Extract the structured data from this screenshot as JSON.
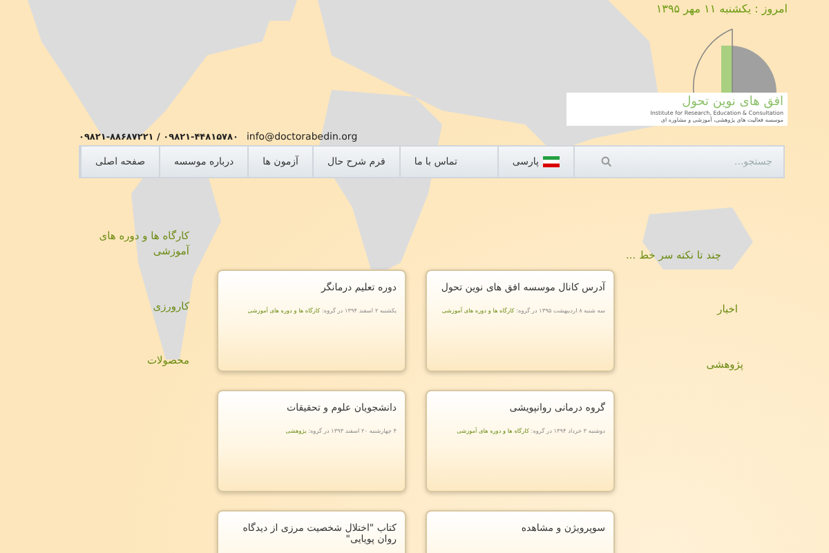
{
  "date_line": "امروز : یکشنبه ۱۱ مهر ۱۳۹۵",
  "logo": {
    "title": "افق های نوین تحول",
    "subtitle_en": "Institute for Research, Education & Consultation",
    "subtitle_fa": "موسسه فعالیت های پژوهشی، آموزشی و مشاوره ای"
  },
  "contact": {
    "phones": "۰۹۸۲۱-۸۸۶۸۷۲۲۱ / ۰۹۸۲۱-۴۴۸۱۵۷۸۰",
    "email": "info@doctorabedin.org"
  },
  "nav": {
    "search": {
      "placeholder": "جستجو..."
    },
    "language": "پارسی",
    "items": [
      {
        "label": "تماس با ما"
      },
      {
        "label": "فرم شرح حال"
      },
      {
        "label": "آزمون ها"
      },
      {
        "label": "درباره موسسه"
      },
      {
        "label": "صفحه اصلی"
      }
    ]
  },
  "right_sidebar": [
    "چند تا نکته سر خط ...",
    "اخبار",
    "پژوهشی"
  ],
  "left_sidebar": [
    "کارگاه ها و دوره های آموزشی",
    "کارورزی",
    "محصولات"
  ],
  "posts": [
    {
      "title": "آدرس کانال موسسه افق های نوین تحول",
      "date": "سه شنبه ۸ اردیبهشت ۱۳۹۵",
      "group_prefix": "در گروه:",
      "group": "کارگاه ها و دوره های آموزشی"
    },
    {
      "title": "دوره تعلیم درمانگر",
      "date": "یکشنبه ۲ اسفند ۱۳۹۴",
      "group_prefix": "در گروه:",
      "group": "کارگاه ها و دوره های آموزشی"
    },
    {
      "title": "گروه درمانی روانپویشی",
      "date": "دوشنبه ۳ خرداد ۱۳۹۴",
      "group_prefix": "در گروه:",
      "group": "کارگاه ها و دوره های آموزشی"
    },
    {
      "title": "دانشجویان علوم و تحقیقات",
      "date": "۴ چهارشنبه ۲۰ اسفند ۱۳۹۳",
      "group_prefix": "در گروه:",
      "group": "پژوهشی"
    },
    {
      "title": "سوپرویژن و مشاهده"
    },
    {
      "title": "کتاب \"اختلال شخصیت مرزی از دیدگاه روان پویایی\""
    }
  ]
}
